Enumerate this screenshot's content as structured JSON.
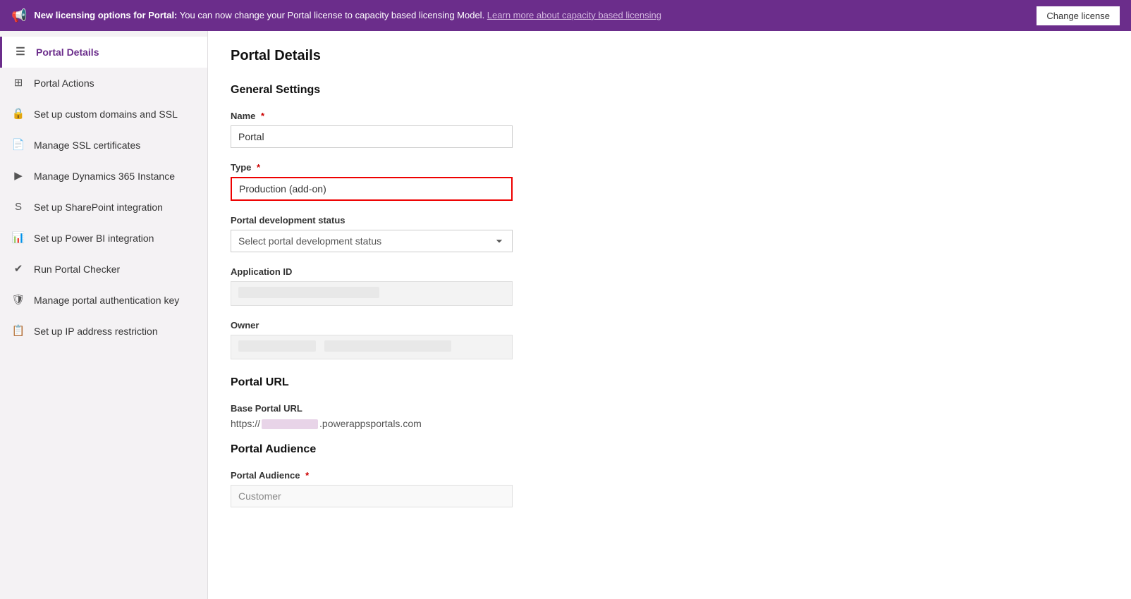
{
  "banner": {
    "icon": "📢",
    "text_prefix": "New licensing options for Portal:",
    "text_body": " You can now change your Portal license to capacity based licensing Model. ",
    "link_text": "Learn more about capacity based licensing",
    "button_label": "Change license"
  },
  "sidebar": {
    "items": [
      {
        "id": "portal-details",
        "label": "Portal Details",
        "icon": "☰",
        "active": true
      },
      {
        "id": "portal-actions",
        "label": "Portal Actions",
        "icon": "⊞",
        "active": false
      },
      {
        "id": "custom-domains",
        "label": "Set up custom domains and SSL",
        "icon": "🔲",
        "active": false
      },
      {
        "id": "ssl-certs",
        "label": "Manage SSL certificates",
        "icon": "📄",
        "active": false
      },
      {
        "id": "dynamics-instance",
        "label": "Manage Dynamics 365 Instance",
        "icon": "▷",
        "active": false
      },
      {
        "id": "sharepoint",
        "label": "Set up SharePoint integration",
        "icon": "S",
        "active": false
      },
      {
        "id": "power-bi",
        "label": "Set up Power BI integration",
        "icon": "📊",
        "active": false
      },
      {
        "id": "portal-checker",
        "label": "Run Portal Checker",
        "icon": "🔲",
        "active": false
      },
      {
        "id": "auth-key",
        "label": "Manage portal authentication key",
        "icon": "🛡",
        "active": false
      },
      {
        "id": "ip-restriction",
        "label": "Set up IP address restriction",
        "icon": "📋",
        "active": false
      }
    ]
  },
  "content": {
    "page_title": "Portal Details",
    "general_settings": {
      "title": "General Settings",
      "name_label": "Name",
      "name_required": true,
      "name_value": "Portal",
      "type_label": "Type",
      "type_required": true,
      "type_placeholder": "Production (add-on)",
      "portal_dev_status_label": "Portal development status",
      "portal_dev_status_placeholder": "Select portal development status",
      "application_id_label": "Application ID",
      "owner_label": "Owner"
    },
    "portal_url": {
      "title": "Portal URL",
      "base_url_label": "Base Portal URL",
      "base_url_prefix": "https://",
      "base_url_suffix": ".powerappsportals.com"
    },
    "portal_audience": {
      "title": "Portal Audience",
      "audience_label": "Portal Audience",
      "audience_required": true,
      "audience_value": "Customer"
    }
  }
}
